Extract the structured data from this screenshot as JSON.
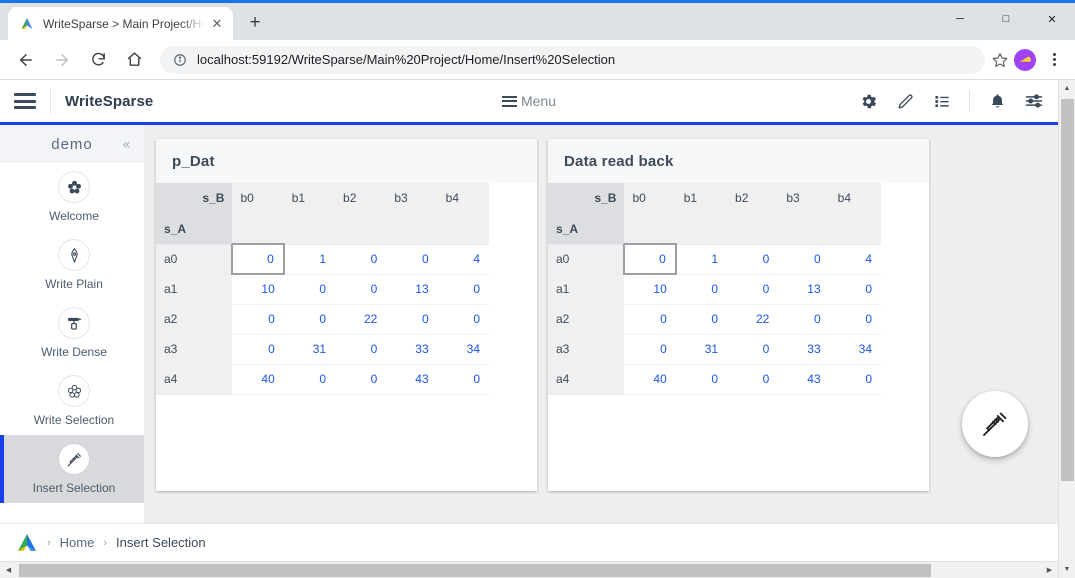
{
  "browser": {
    "tab": {
      "title": "WriteSparse > Main Project/Hom",
      "favicon_name": "writesparse-logo-icon",
      "close_label": "✕"
    },
    "new_tab_label": "+",
    "window_controls": {
      "minimize": "─",
      "maximize": "□",
      "close": "✕"
    },
    "nav": {
      "back": "←",
      "forward": "→",
      "reload": "⟳",
      "home": "⌂"
    },
    "omnibox": {
      "url": "localhost:59192/WriteSparse/Main%20Project/Home/Insert%20Selection",
      "info_icon": "ⓘ",
      "star_icon": "☆"
    },
    "extension_icon_name": "cheese-extension-icon",
    "menu_icon_name": "three-dot-menu-icon"
  },
  "app": {
    "title": "WriteSparse",
    "menu_label": "Menu",
    "header_icons": [
      {
        "name": "gear-icon",
        "glyph": "⚙"
      },
      {
        "name": "pencil-icon",
        "glyph": "✎"
      },
      {
        "name": "list-icon",
        "glyph": "☰"
      },
      {
        "name": "bell-icon",
        "glyph": "ὑ4"
      },
      {
        "name": "sliders-icon",
        "glyph": "☲"
      }
    ],
    "accent_color": "#1840e8"
  },
  "sidebar": {
    "header": "demo",
    "collapse_icon": "«",
    "items": [
      {
        "label": "Welcome",
        "icon": "flower-icon",
        "active": false
      },
      {
        "label": "Write Plain",
        "icon": "pen-nib-icon",
        "active": false
      },
      {
        "label": "Write Dense",
        "icon": "paint-roller-icon",
        "active": false
      },
      {
        "label": "Write Selection",
        "icon": "flower-outline-icon",
        "active": false
      },
      {
        "label": "Insert Selection",
        "icon": "syringe-icon",
        "active": true
      }
    ]
  },
  "panels": [
    {
      "title": "p_Dat",
      "corner_col_label": "s_B",
      "corner_row_label": "s_A",
      "columns": [
        "b0",
        "b1",
        "b2",
        "b3",
        "b4"
      ],
      "rows": [
        "a0",
        "a1",
        "a2",
        "a3",
        "a4"
      ],
      "values": [
        [
          0,
          1,
          0,
          0,
          4
        ],
        [
          10,
          0,
          0,
          13,
          0
        ],
        [
          0,
          0,
          22,
          0,
          0
        ],
        [
          0,
          31,
          0,
          33,
          34
        ],
        [
          40,
          0,
          0,
          43,
          0
        ]
      ],
      "selected_cell": {
        "row": 0,
        "col": 0
      }
    },
    {
      "title": "Data read back",
      "corner_col_label": "s_B",
      "corner_row_label": "s_A",
      "columns": [
        "b0",
        "b1",
        "b2",
        "b3",
        "b4"
      ],
      "rows": [
        "a0",
        "a1",
        "a2",
        "a3",
        "a4"
      ],
      "values": [
        [
          0,
          1,
          0,
          0,
          4
        ],
        [
          10,
          0,
          0,
          13,
          0
        ],
        [
          0,
          0,
          22,
          0,
          0
        ],
        [
          0,
          31,
          0,
          33,
          34
        ],
        [
          40,
          0,
          0,
          43,
          0
        ]
      ],
      "selected_cell": {
        "row": 0,
        "col": 0
      }
    }
  ],
  "fab": {
    "icon": "syringe-icon"
  },
  "footer": {
    "logo_name": "writesparse-logo-icon",
    "separator": "›",
    "home_label": "Home",
    "current_label": "Insert Selection"
  },
  "colors": {
    "value_blue": "#1a56e8",
    "header_gray": "#f0f0f0",
    "corner_gray": "#dcdee1",
    "content_bg": "#eeeeee",
    "active_item_bg": "#d7d9dd"
  }
}
